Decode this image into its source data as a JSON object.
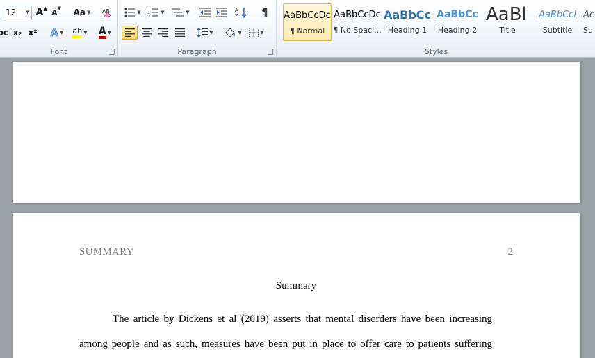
{
  "ribbon": {
    "font": {
      "label": "Font",
      "size": "12",
      "grow_label": "A",
      "shrink_label": "A",
      "case_label": "Aa",
      "strike_label": "abc",
      "subscript_label": "x₂",
      "superscript_label": "x²",
      "effects_label": "A",
      "highlight_label": "ab",
      "color_label": "A",
      "highlight_color": "#ffff00",
      "font_color": "#c00000"
    },
    "paragraph": {
      "label": "Paragraph",
      "pilcrow": "¶"
    },
    "styles": {
      "label": "Styles",
      "items": [
        {
          "sample": "AaBbCcDc",
          "label": "¶ Normal"
        },
        {
          "sample": "AaBbCcDc",
          "label": "¶ No Spaci..."
        },
        {
          "sample": "AaBbCc",
          "label": "Heading 1"
        },
        {
          "sample": "AaBbCc",
          "label": "Heading 2"
        },
        {
          "sample": "AaBl",
          "label": "Title"
        },
        {
          "sample": "AaBbCcl",
          "label": "Subtitle"
        },
        {
          "sample": "Ac",
          "label": "Su"
        }
      ]
    }
  },
  "document": {
    "header_left": "SUMMARY",
    "header_right": "2",
    "title": "Summary",
    "lines": [
      "The article by Dickens et al (2019) asserts that mental disorders have been increasing",
      "among people and as such, measures have been put in place to offer care to patients suffering"
    ]
  }
}
